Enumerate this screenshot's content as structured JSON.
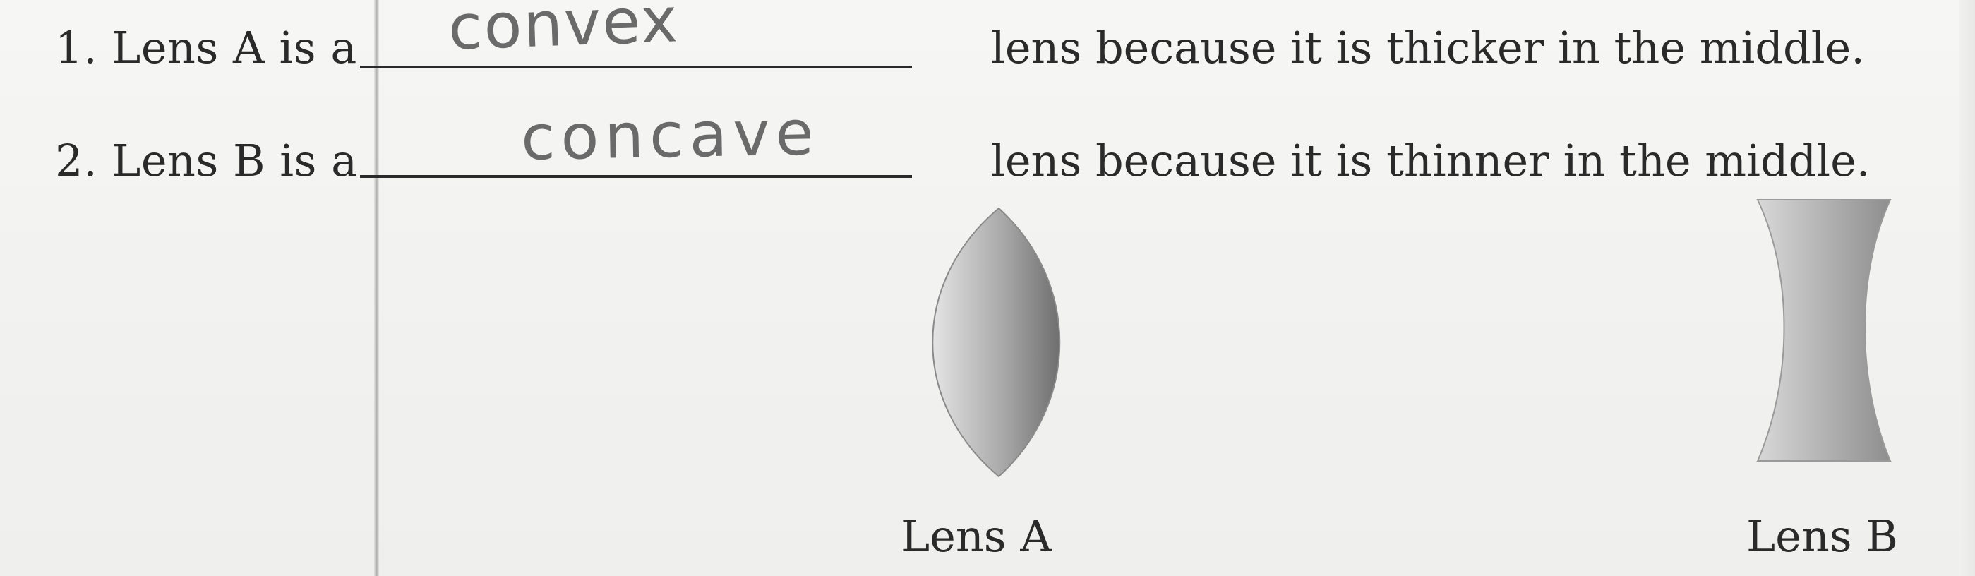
{
  "questions": [
    {
      "number": "1.",
      "prefix": "Lens A is a",
      "answer": "convex",
      "suffix": "lens because it is thicker in the middle."
    },
    {
      "number": "2.",
      "prefix": "Lens B is a",
      "answer": "concave",
      "suffix": "lens because it is thinner in the middle."
    }
  ],
  "lenses": [
    {
      "label": "Lens A",
      "shape": "convex"
    },
    {
      "label": "Lens B",
      "shape": "concave"
    }
  ],
  "colors": {
    "ink": "#2a2a2a",
    "pencil": "#6a6a6a",
    "paper": "#f2f2f0",
    "margin_line": "#8c8c8c"
  }
}
